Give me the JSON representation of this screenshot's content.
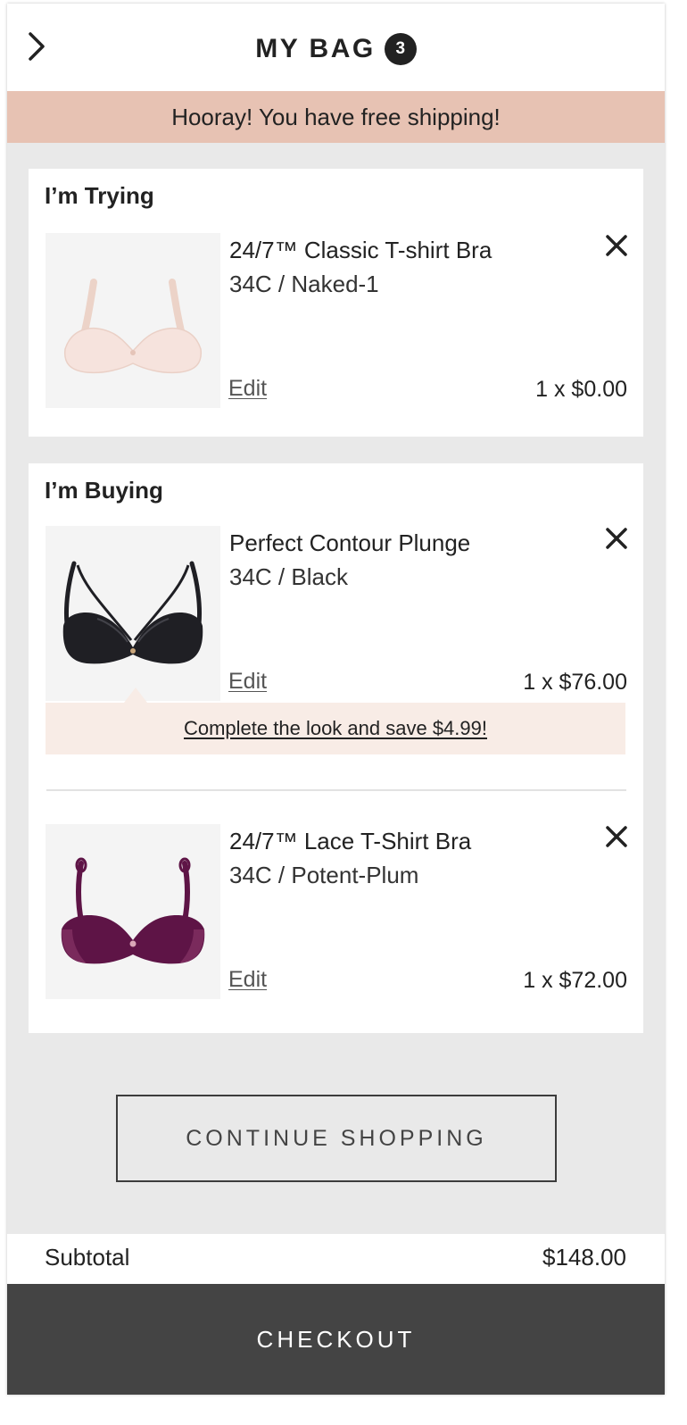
{
  "header": {
    "title": "MY BAG",
    "item_count": "3",
    "back_icon": "chevron-right-icon"
  },
  "promo": {
    "text": "Hooray! You have free shipping!"
  },
  "trying": {
    "title": "I’m Trying",
    "items": [
      {
        "name": "24/7™ Classic T-shirt Bra",
        "variant": "34C / Naked-1",
        "edit_label": "Edit",
        "price": "1 x $0.00",
        "color": "#f6e3dd"
      }
    ]
  },
  "buying": {
    "title": "I’m Buying",
    "items": [
      {
        "name": "Perfect Contour Plunge",
        "variant": "34C / Black",
        "edit_label": "Edit",
        "price": "1 x $76.00",
        "color": "#1f1f24"
      },
      {
        "name": "24/7™ Lace T-Shirt Bra",
        "variant": "34C / Potent-Plum",
        "edit_label": "Edit",
        "price": "1 x $72.00",
        "color": "#5e1446"
      }
    ],
    "upsell_text": "Complete the look and save $4.99!"
  },
  "continue_label": "CONTINUE SHOPPING",
  "subtotal": {
    "label": "Subtotal",
    "value": "$148.00"
  },
  "checkout_label": "CHECKOUT",
  "colors": {
    "promo_bg": "#e7c2b3",
    "upsell_bg": "#f8ece6",
    "checkout_bg": "#444444",
    "page_bg": "#e9e9e9"
  }
}
